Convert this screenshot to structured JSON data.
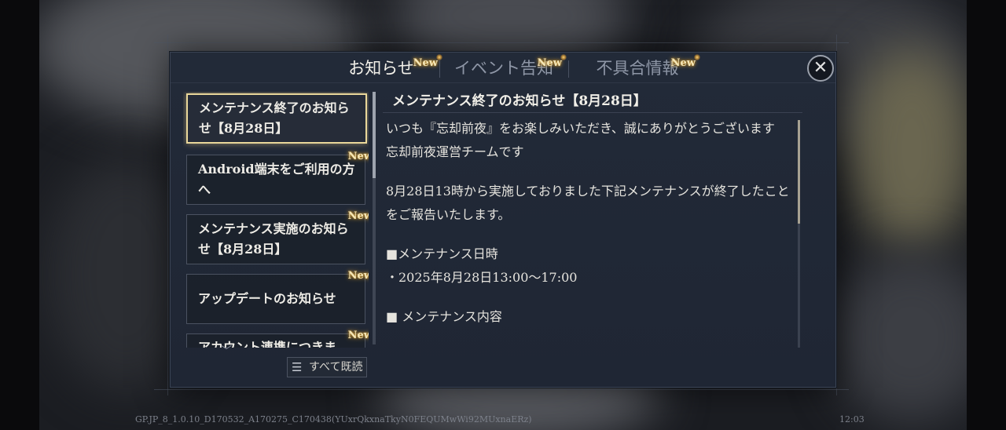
{
  "tabs": [
    {
      "label": "お知らせ",
      "badge": "New",
      "active": true
    },
    {
      "label": "イベント告知",
      "badge": "New",
      "active": false
    },
    {
      "label": "不具合情報",
      "badge": "New",
      "active": false
    }
  ],
  "close_icon": "close-x-icon",
  "notice_list": [
    {
      "label": "メンテナンス終了のお知らせ【8月28日】",
      "badge": "",
      "selected": true
    },
    {
      "label": "Android端末をご利用の方へ",
      "badge": "New",
      "selected": false
    },
    {
      "label": "メンテナンス実施のお知らせ【8月28日】",
      "badge": "New",
      "selected": false
    },
    {
      "label": "アップデートのお知らせ",
      "badge": "New",
      "selected": false
    },
    {
      "label": "アカウント連携につきま",
      "badge": "New",
      "selected": false
    }
  ],
  "read_all_label": "すべて既読",
  "read_all_icon": "checklist-icon",
  "scroll_down_icon": "chevron-down-icon",
  "content": {
    "title": "メンテナンス終了のお知らせ【8月28日】",
    "lines": [
      "いつも『忘却前夜』をお楽しみいただき、誠にありがとうございます",
      "忘却前夜運営チームです",
      "",
      "8月28日13時から実施しておりました下記メンテナンスが終了したことをご報告いたします。",
      "",
      "■メンテナンス日時",
      "・2025年8月28日13:00～17:00",
      "",
      "■ メンテナンス内容"
    ]
  },
  "footer": {
    "build": "GP.JP_8_1.0.10_D170532_A170275_C170438(YUxrQkxnaTkyN0FEQUMwWi92MUxnaERz)",
    "time": "12:03"
  },
  "colors": {
    "accent_gold": "#e9d79a",
    "badge_glow": "#f0b43a",
    "panel_bg": "#222a38"
  }
}
